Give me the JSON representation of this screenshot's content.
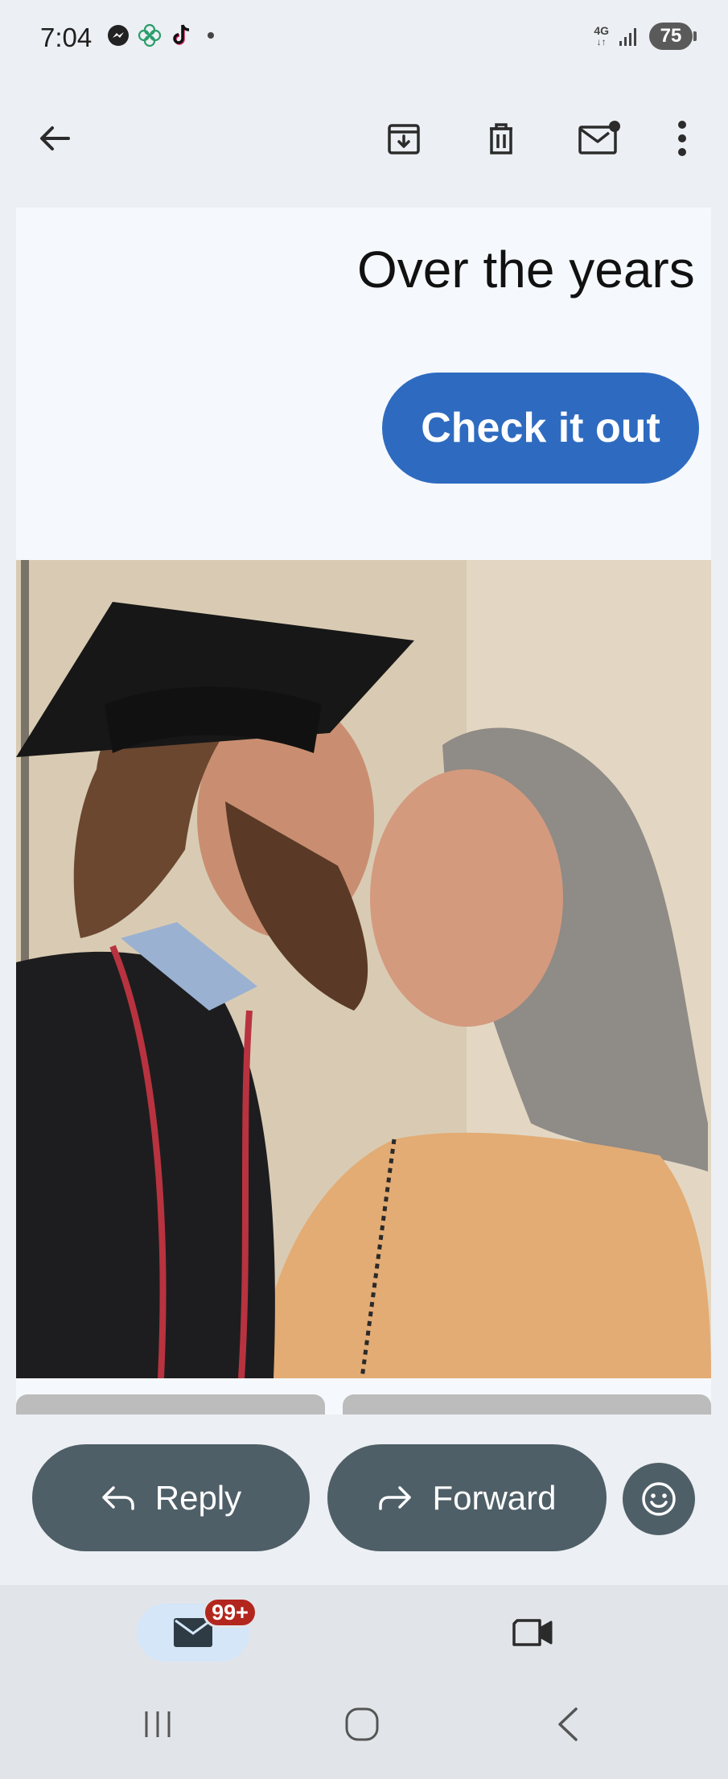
{
  "status": {
    "time": "7:04",
    "network": "4G",
    "battery": "75",
    "notification_icons": [
      "messenger-icon",
      "app-icon",
      "tiktok-icon"
    ]
  },
  "toolbar": {
    "icons": [
      "back-arrow-icon",
      "archive-icon",
      "delete-icon",
      "mark-unread-icon",
      "more-options-icon"
    ]
  },
  "email": {
    "snippet_text": "Over the years",
    "cta_label": "Check it out"
  },
  "actions": {
    "reply_label": "Reply",
    "forward_label": "Forward",
    "emoji_icon": "emoji-icon"
  },
  "bottom_nav": {
    "mail_badge": "99+",
    "mail_icon": "mail-icon",
    "meet_icon": "video-icon"
  },
  "colors": {
    "cta": "#2e6bc0",
    "action_button": "#4f5f68",
    "badge": "#b3261e",
    "nav_pill": "#d4e6f7"
  }
}
